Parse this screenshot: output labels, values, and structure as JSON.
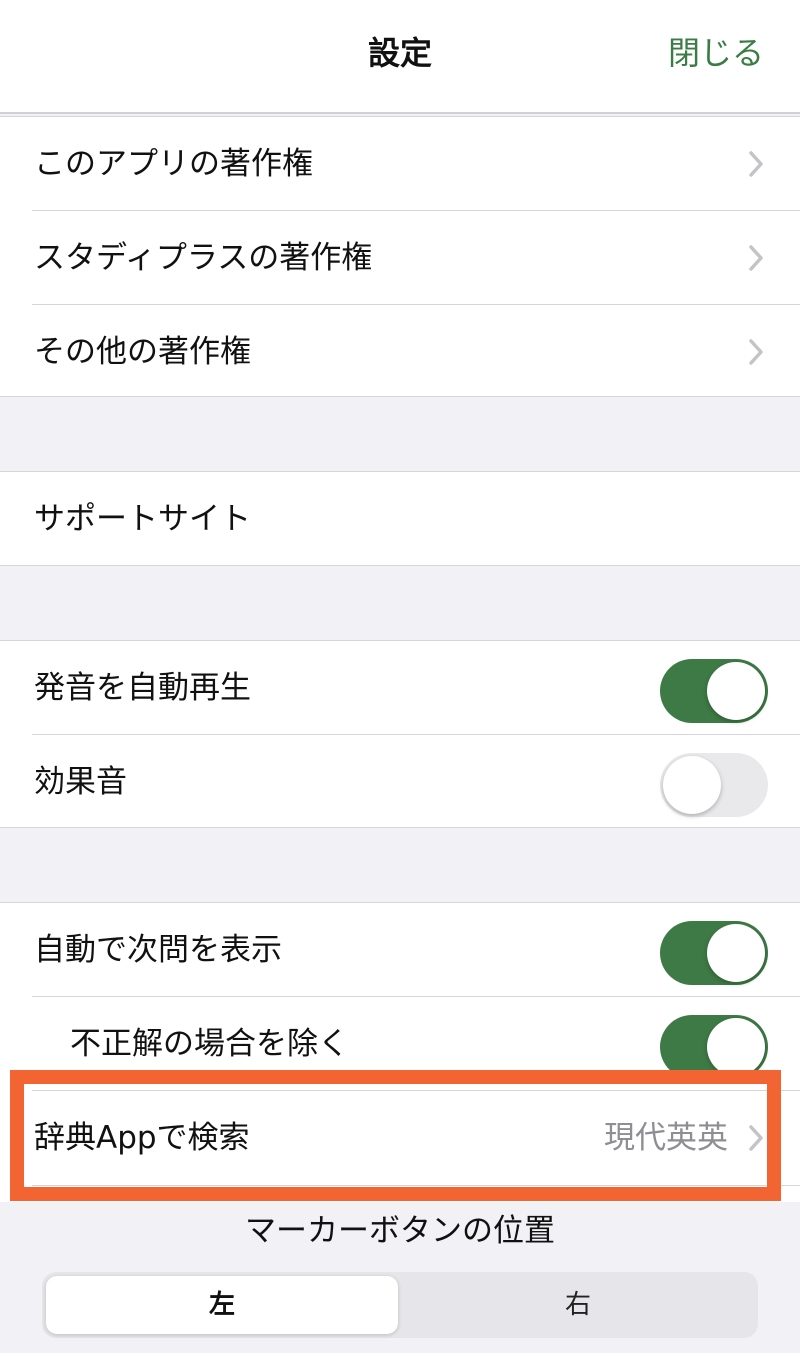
{
  "nav": {
    "title": "設定",
    "close_label": "閉じる"
  },
  "copyright_group": {
    "items": [
      {
        "label": "このアプリの著作権",
        "icon": "chevron-right-icon"
      },
      {
        "label": "スタディプラスの著作権",
        "icon": "chevron-right-icon"
      },
      {
        "label": "その他の著作権",
        "icon": "chevron-right-icon"
      }
    ]
  },
  "support_group": {
    "items": [
      {
        "label": "サポートサイト"
      }
    ]
  },
  "sound_group": {
    "items": [
      {
        "label": "発音を自動再生",
        "toggle": true
      },
      {
        "label": "効果音",
        "toggle": false
      }
    ]
  },
  "study_group": {
    "items": [
      {
        "label": "自動で次問を表示",
        "toggle": true
      },
      {
        "label": "不正解の場合を除く",
        "toggle": true
      },
      {
        "label": "辞典Appで検索",
        "value": "現代英英",
        "icon": "chevron-right-icon"
      }
    ]
  },
  "marker_section": {
    "title": "マーカーボタンの位置",
    "options": [
      "左",
      "右"
    ],
    "selected": "左"
  },
  "colors": {
    "accent": "#3e7a45",
    "highlight_box": "#f26532",
    "background": "#f2f2f6"
  }
}
